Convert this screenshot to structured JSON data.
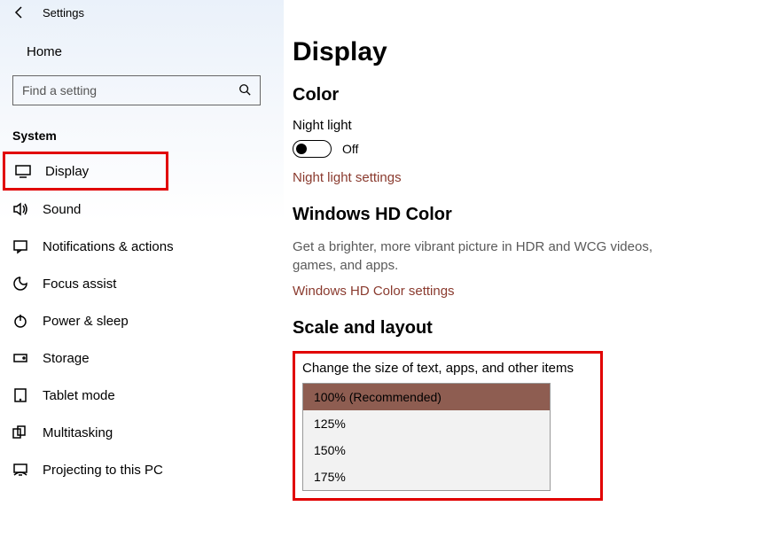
{
  "topbar": {
    "title": "Settings"
  },
  "home": {
    "label": "Home"
  },
  "search": {
    "placeholder": "Find a setting"
  },
  "sidebar": {
    "header": "System",
    "items": [
      {
        "label": "Display"
      },
      {
        "label": "Sound"
      },
      {
        "label": "Notifications & actions"
      },
      {
        "label": "Focus assist"
      },
      {
        "label": "Power & sleep"
      },
      {
        "label": "Storage"
      },
      {
        "label": "Tablet mode"
      },
      {
        "label": "Multitasking"
      },
      {
        "label": "Projecting to this PC"
      }
    ]
  },
  "main": {
    "title": "Display",
    "color": {
      "header": "Color",
      "night_label": "Night light",
      "toggle_state": "Off",
      "link": "Night light settings"
    },
    "hd": {
      "header": "Windows HD Color",
      "desc": "Get a brighter, more vibrant picture in HDR and WCG videos, games, and apps.",
      "link": "Windows HD Color settings"
    },
    "scale": {
      "header": "Scale and layout",
      "label": "Change the size of text, apps, and other items",
      "options": [
        "100% (Recommended)",
        "125%",
        "150%",
        "175%"
      ]
    }
  }
}
